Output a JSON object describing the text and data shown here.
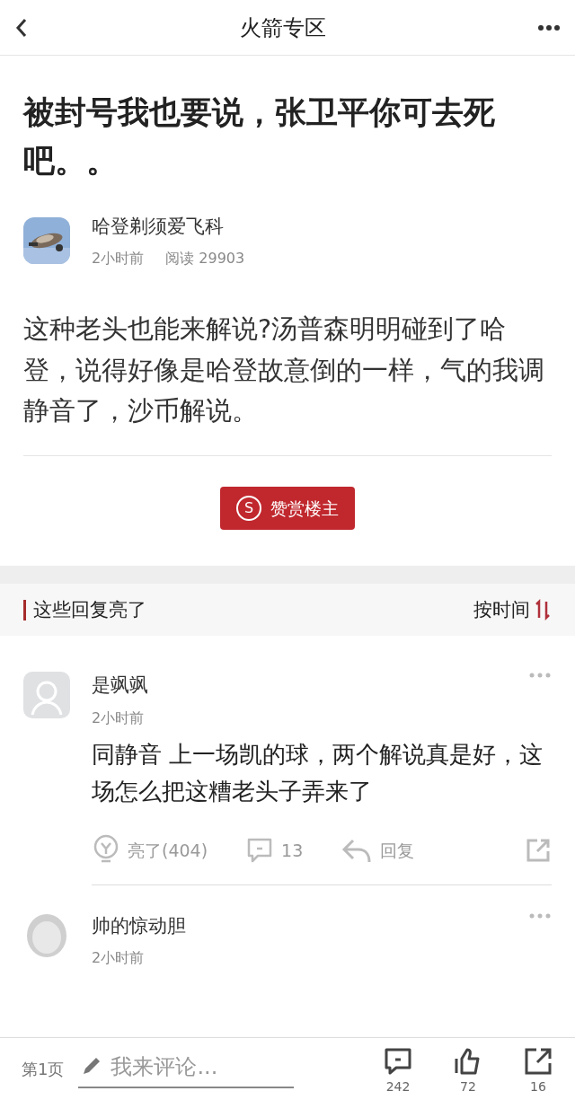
{
  "header": {
    "title": "火箭专区"
  },
  "post": {
    "title": "被封号我也要说，张卫平你可去死吧。。",
    "author": "哈登剃须爱飞科",
    "time": "2小时前",
    "reads": "阅读 29903",
    "body": "这种老头也能来解说?汤普森明明碰到了哈登，说得好像是哈登故意倒的一样，气的我调静音了，沙币解说。",
    "reward_button": "赞赏楼主",
    "reward_icon": "S"
  },
  "replies_section": {
    "title": "这些回复亮了",
    "sort": "按时间"
  },
  "replies": [
    {
      "kind": "placeholder",
      "name": "是飒飒",
      "time": "2小时前",
      "text": "同静音 上一场凯的球，两个解说真是好，这场怎么把这糟老头子弄来了",
      "actions": {
        "light": "亮了(404)",
        "comments": "13",
        "reply": "回复"
      }
    },
    {
      "kind": "figure",
      "name": "帅的惊动胆",
      "time": "2小时前"
    }
  ],
  "bottom_bar": {
    "page": "第1页",
    "placeholder": "我来评论...",
    "comments": "242",
    "likes": "72",
    "shares": "16"
  }
}
